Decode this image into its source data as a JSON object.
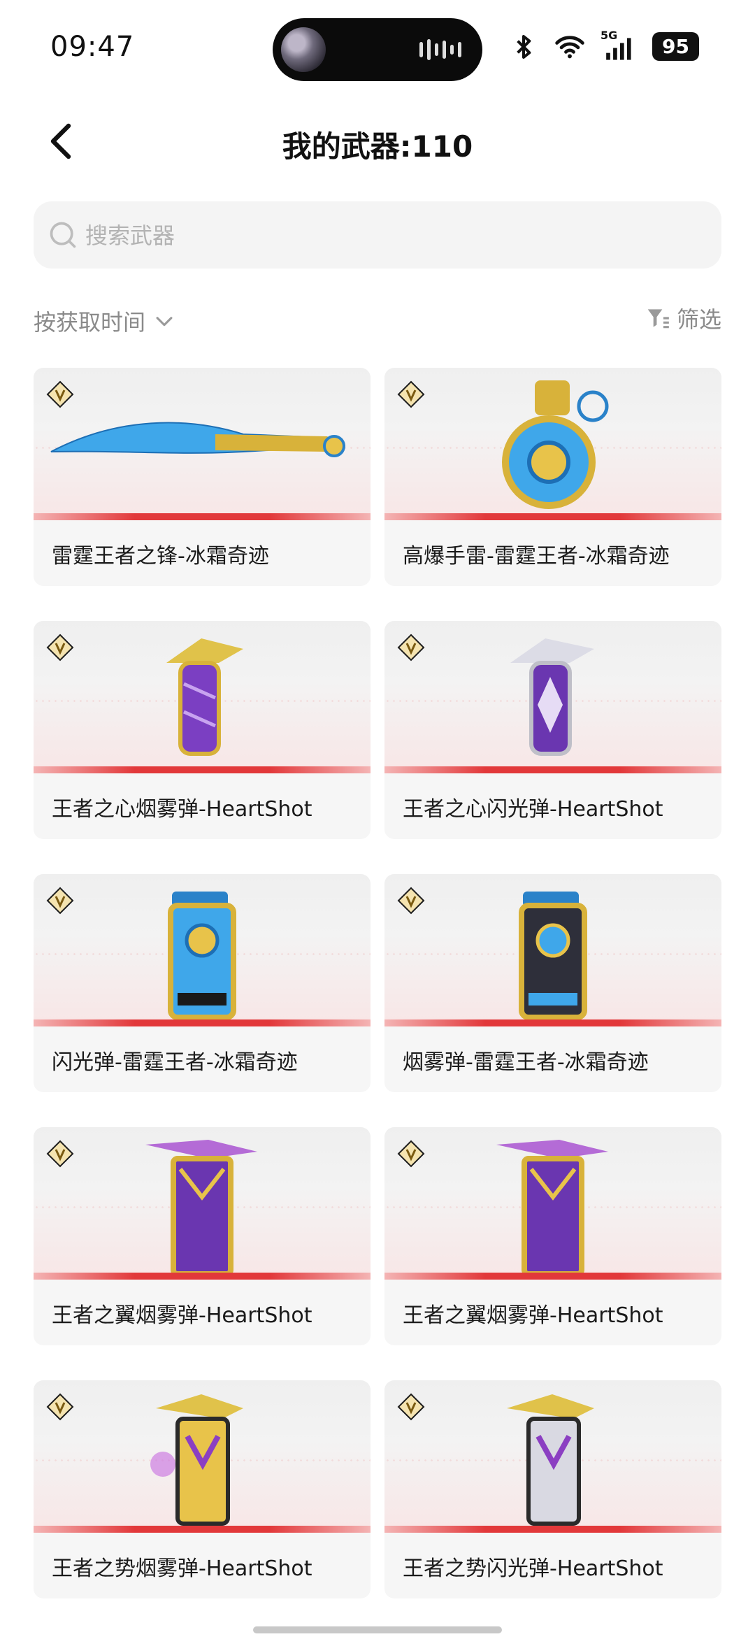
{
  "status_bar": {
    "time": "09:47",
    "network": "5G",
    "battery": "95"
  },
  "header": {
    "title": "我的武器:110"
  },
  "search": {
    "placeholder": "搜索武器"
  },
  "toolbar": {
    "sort_label": "按获取时间",
    "filter_label": "筛选"
  },
  "items": [
    {
      "name": "雷霆王者之锋-冰霜奇迹",
      "icon": "blade-weapon-icon"
    },
    {
      "name": "高爆手雷-雷霆王者-冰霜奇迹",
      "icon": "grenade-icon"
    },
    {
      "name": "王者之心烟雾弹-HeartShot",
      "icon": "smoke-grenade-icon"
    },
    {
      "name": "王者之心闪光弹-HeartShot",
      "icon": "flash-grenade-icon"
    },
    {
      "name": "闪光弹-雷霆王者-冰霜奇迹",
      "icon": "flash-grenade-icon"
    },
    {
      "name": "烟雾弹-雷霆王者-冰霜奇迹",
      "icon": "smoke-grenade-icon"
    },
    {
      "name": "王者之翼烟雾弹-HeartShot",
      "icon": "smoke-grenade-icon"
    },
    {
      "name": "王者之翼烟雾弹-HeartShot",
      "icon": "smoke-grenade-icon"
    },
    {
      "name": "王者之势烟雾弹-HeartShot",
      "icon": "smoke-grenade-icon"
    },
    {
      "name": "王者之势闪光弹-HeartShot",
      "icon": "flash-grenade-icon"
    }
  ],
  "colors": {
    "accent_red": "#e2383a",
    "card_bg": "#f6f6f6",
    "muted_text": "#8a8a8a"
  }
}
